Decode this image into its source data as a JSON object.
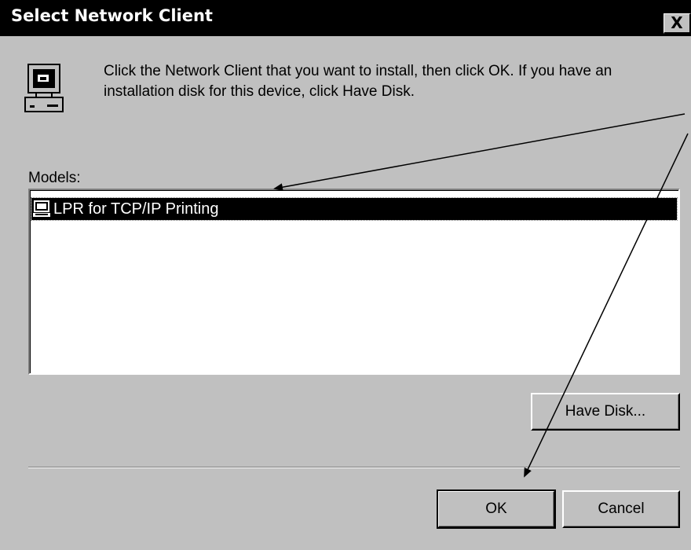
{
  "window": {
    "title": "Select Network Client",
    "close_glyph": "X"
  },
  "instructions": {
    "text": "Click the Network Client that you want to install, then click OK. If you have an installation disk for this device, click Have Disk."
  },
  "models": {
    "label": "Models:",
    "items": [
      {
        "label": "LPR for TCP/IP Printing",
        "icon": "network-computer-icon",
        "selected": true
      }
    ]
  },
  "buttons": {
    "have_disk": "Have Disk...",
    "ok": "OK",
    "cancel": "Cancel"
  },
  "colors": {
    "dialog_face": "#c0c0c0",
    "titlebar": "#000000",
    "selection": "#000000"
  }
}
